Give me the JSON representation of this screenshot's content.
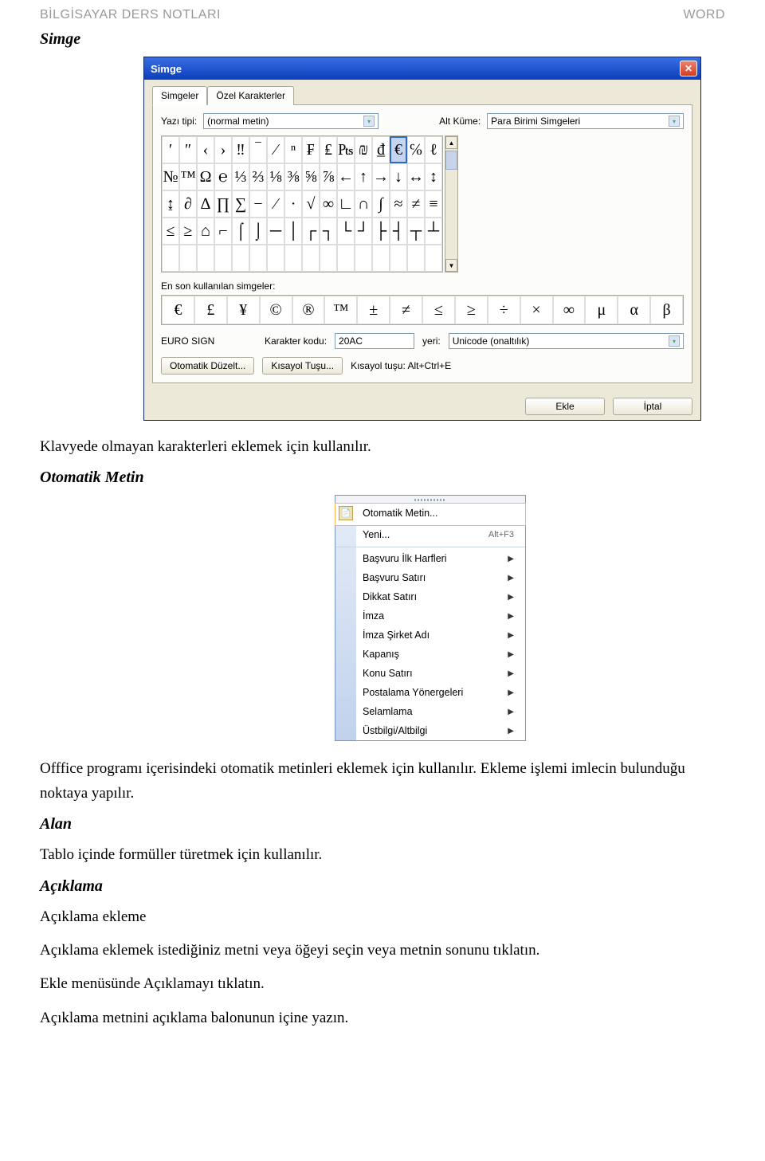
{
  "header": {
    "left": "BİLGİSAYAR DERS NOTLARI",
    "right": "WORD"
  },
  "heading_simge": "Simge",
  "dialog": {
    "title": "Simge",
    "tabs": {
      "symbols": "Simgeler",
      "special": "Özel Karakterler"
    },
    "font_label": "Yazı tipi:",
    "font_value": "(normal metin)",
    "subset_label": "Alt Küme:",
    "subset_value": "Para Birimi Simgeleri",
    "grid": {
      "r0": [
        "′",
        "″",
        "‹",
        "›",
        "‼",
        "‾",
        "⁄",
        "ⁿ",
        "₣",
        "₤",
        "₧",
        "₪",
        "₫",
        "€",
        "℅",
        "ℓ"
      ],
      "r1": [
        "№",
        "™",
        "Ω",
        "℮",
        "⅓",
        "⅔",
        "⅛",
        "⅜",
        "⅝",
        "⅞",
        "←",
        "↑",
        "→",
        "↓",
        "↔",
        "↕"
      ],
      "r2": [
        "↨",
        "∂",
        "∆",
        "∏",
        "∑",
        "−",
        "∕",
        "∙",
        "√",
        "∞",
        "∟",
        "∩",
        "∫",
        "≈",
        "≠",
        "≡"
      ],
      "r3": [
        "≤",
        "≥",
        "⌂",
        "⌐",
        "⌠",
        "⌡",
        "─",
        "│",
        "┌",
        "┐",
        "└",
        "┘",
        "├",
        "┤",
        "┬",
        "┴"
      ],
      "r4": [
        "",
        "",
        "",
        "",
        "",
        "",
        "",
        "",
        "",
        "",
        "",
        "",
        "",
        "",
        "",
        ""
      ]
    },
    "selected_index": 13,
    "recent_label": "En son kullanılan simgeler:",
    "recent": [
      "€",
      "£",
      "¥",
      "©",
      "®",
      "™",
      "±",
      "≠",
      "≤",
      "≥",
      "÷",
      "×",
      "∞",
      "μ",
      "α",
      "β"
    ],
    "char_name": "EURO SIGN",
    "code_label": "Karakter kodu:",
    "code_value": "20AC",
    "from_label": "yeri:",
    "from_value": "Unicode (onaltılık)",
    "btn_autocorrect": "Otomatik Düzelt...",
    "btn_shortcut": "Kısayol Tuşu...",
    "shortcut_text": "Kısayol tuşu: Alt+Ctrl+E",
    "btn_insert": "Ekle",
    "btn_cancel": "İptal"
  },
  "body1": "Klavyede olmayan karakterleri eklemek için kullanılır.",
  "heading_otomatik": "Otomatik Metin",
  "menu": {
    "item_autotext": "Otomatik Metin...",
    "item_new": "Yeni...",
    "item_new_shortcut": "Alt+F3",
    "items": [
      "Başvuru İlk Harfleri",
      "Başvuru Satırı",
      "Dikkat Satırı",
      "İmza",
      "İmza Şirket Adı",
      "Kapanış",
      "Konu Satırı",
      "Postalama Yönergeleri",
      "Selamlama",
      "Üstbilgi/Altbilgi"
    ]
  },
  "body2": "Offfice programı içerisindeki otomatik metinleri eklemek için kullanılır. Ekleme işlemi imlecin bulunduğu noktaya yapılır.",
  "heading_alan": "Alan",
  "body3": "Tablo içinde formüller türetmek için kullanılır.",
  "heading_aciklama": "Açıklama",
  "body4": "Açıklama ekleme",
  "body5": "Açıklama eklemek istediğiniz metni veya öğeyi seçin veya metnin sonunu tıklatın.",
  "body6": "Ekle menüsünde Açıklamayı tıklatın.",
  "body7": "Açıklama metnini açıklama balonunun içine yazın."
}
